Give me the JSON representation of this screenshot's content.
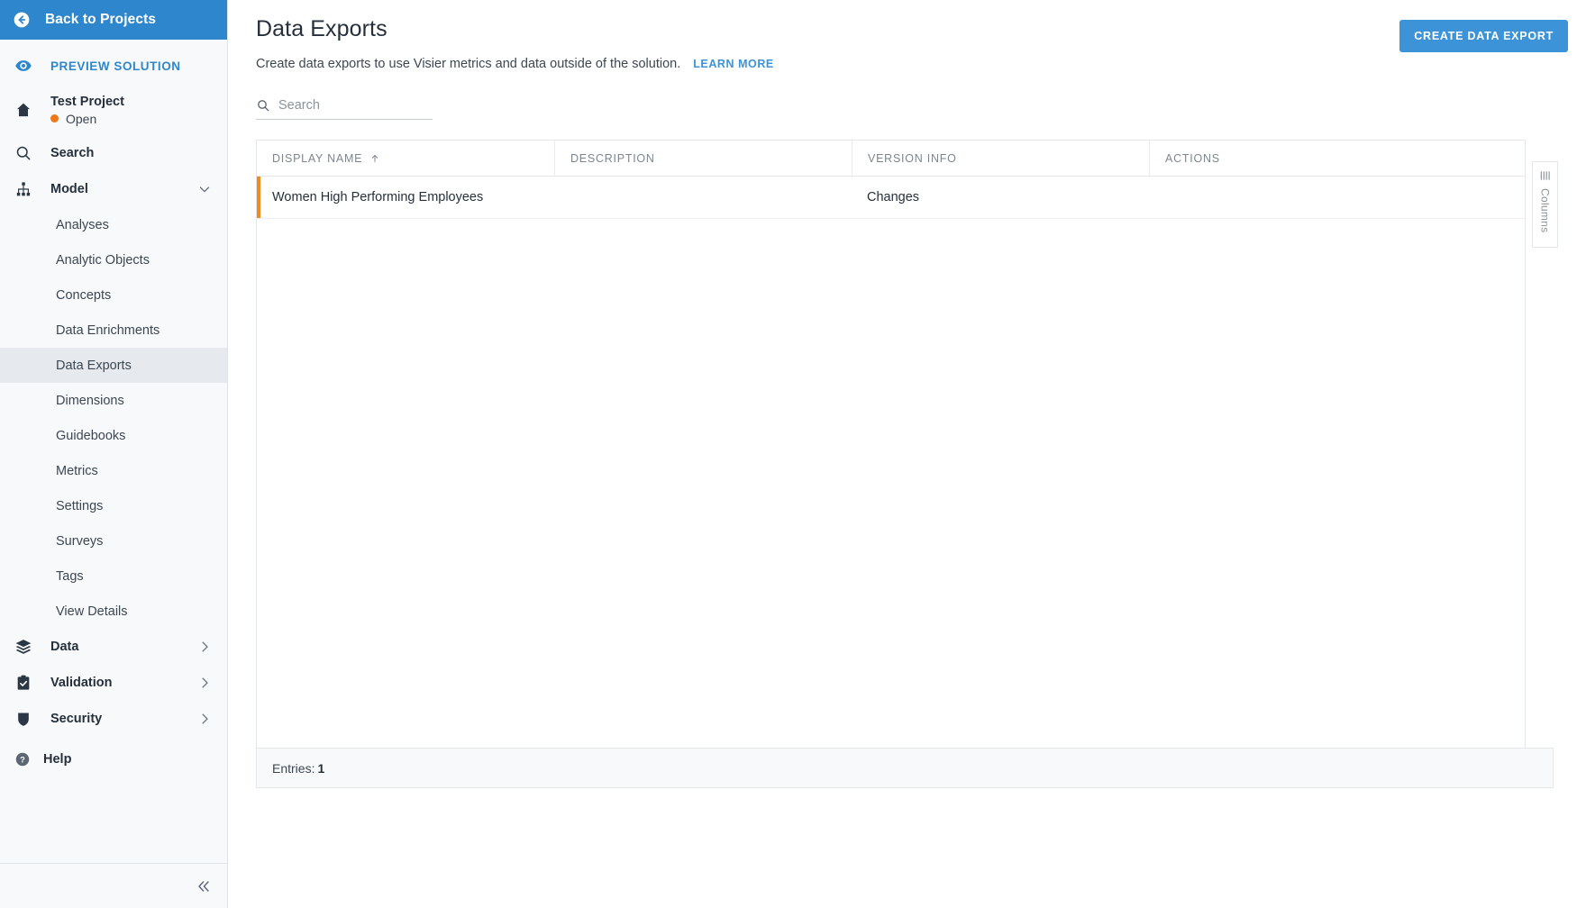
{
  "sidebar": {
    "back": {
      "label": "Back to Projects",
      "icon": "back-arrow-circle-icon"
    },
    "preview": {
      "label": "PREVIEW SOLUTION",
      "icon": "eye-icon"
    },
    "project": {
      "name": "Test Project",
      "status": "Open",
      "status_color": "#f07818",
      "icon": "home-icon"
    },
    "search": {
      "label": "Search",
      "icon": "search-icon"
    },
    "model": {
      "label": "Model",
      "icon": "model-hierarchy-icon",
      "expanded": true,
      "chevron": "chevron-down-icon"
    },
    "model_items": [
      {
        "label": "Analyses",
        "active": false
      },
      {
        "label": "Analytic Objects",
        "active": false
      },
      {
        "label": "Concepts",
        "active": false
      },
      {
        "label": "Data Enrichments",
        "active": false
      },
      {
        "label": "Data Exports",
        "active": true
      },
      {
        "label": "Dimensions",
        "active": false
      },
      {
        "label": "Guidebooks",
        "active": false
      },
      {
        "label": "Metrics",
        "active": false
      },
      {
        "label": "Settings",
        "active": false
      },
      {
        "label": "Surveys",
        "active": false
      },
      {
        "label": "Tags",
        "active": false
      },
      {
        "label": "View Details",
        "active": false
      }
    ],
    "sections": [
      {
        "label": "Data",
        "icon": "layers-icon",
        "chevron": "chevron-right-icon"
      },
      {
        "label": "Validation",
        "icon": "clipboard-check-icon",
        "chevron": "chevron-right-icon"
      },
      {
        "label": "Security",
        "icon": "shield-icon",
        "chevron": "chevron-right-icon"
      }
    ],
    "help": {
      "label": "Help",
      "icon": "help-circle-icon"
    },
    "collapse": {
      "icon": "double-chevron-left-icon"
    },
    "header_color": "#2e87cd"
  },
  "main": {
    "title": "Data Exports",
    "subtitle": "Create data exports to use Visier metrics and data outside of the solution.",
    "learn_more": "LEARN MORE",
    "create_button": "CREATE DATA EXPORT",
    "accent_color": "#3d93d8",
    "search": {
      "value": "",
      "placeholder": "Search",
      "icon": "search-icon"
    },
    "table": {
      "columns": [
        {
          "label": "DISPLAY NAME",
          "sorted": true,
          "sort_icon": "sort-ascending-icon"
        },
        {
          "label": "DESCRIPTION",
          "sorted": false
        },
        {
          "label": "VERSION INFO",
          "sorted": false
        },
        {
          "label": "ACTIONS",
          "sorted": false
        }
      ],
      "rows": [
        {
          "display_name": "Women High Performing Employees",
          "description": "",
          "version_info": "Changes",
          "actions": "",
          "accent_color": "#f08b20"
        }
      ],
      "footer_label": "Entries:",
      "footer_count": "1"
    },
    "columns_panel": {
      "label": "Columns",
      "icon": "columns-grid-icon"
    }
  }
}
